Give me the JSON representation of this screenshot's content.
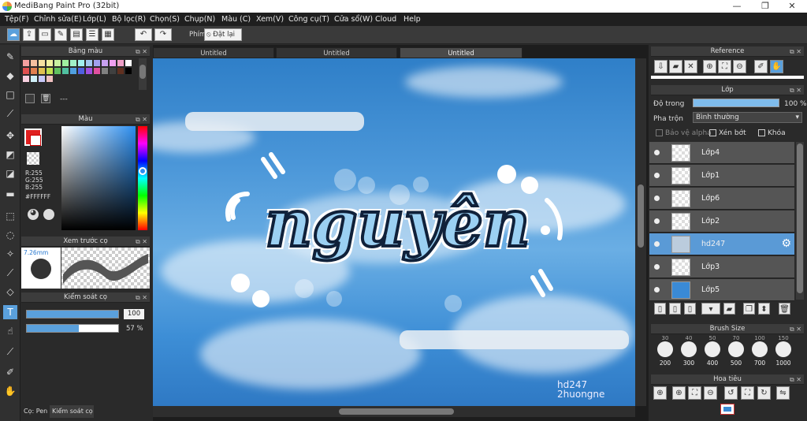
{
  "window": {
    "title": "MediBang Paint Pro (32bit)",
    "controls": [
      "—",
      "❐",
      "✕"
    ]
  },
  "menu": [
    "Tệp(F)",
    "Chỉnh sửa(E)",
    "Lớp(L)",
    "Bộ lọc(R)",
    "Chọn(S)",
    "Chụp(N)",
    "Màu (C)",
    "Xem(V)",
    "Công cụ(T)",
    "Cửa sổ(W)",
    "Cloud",
    "Help"
  ],
  "toolbar": {
    "hotkey_label": "Phím",
    "reset_label": "Đặt lại"
  },
  "palette": {
    "title": "Bảng màu",
    "set_name": "---",
    "colors": [
      "#f4a0a0",
      "#f5c0a0",
      "#f5e0a0",
      "#f0f0a0",
      "#c8f0a0",
      "#a0f0a0",
      "#a0f0c8",
      "#a0f0f0",
      "#a0c8f0",
      "#a0a0f0",
      "#c8a0f0",
      "#f0a0f0",
      "#f0a0c8",
      "#ffffff",
      "#e05050",
      "#e08050",
      "#e0c050",
      "#c0e050",
      "#60c060",
      "#50c0a0",
      "#50a0e0",
      "#5060e0",
      "#a050e0",
      "#e050a0",
      "#808080",
      "#404040",
      "#603020",
      "#000000",
      "#f8d0e0",
      "#d0f0f8",
      "#c8c8f8",
      "#f0c0c0"
    ]
  },
  "color": {
    "title": "Màu",
    "r": "R:255",
    "g": "G:255",
    "b": "B:255",
    "hex": "#FFFFFF"
  },
  "brush_preview": {
    "title": "Xem trước cọ",
    "size": "7.26mm"
  },
  "brush_control": {
    "title": "Kiểm soát cọ",
    "size_value": "100",
    "opacity_value": "57 %",
    "opacity": 0.57,
    "size": 1.0
  },
  "bottom_tabs": [
    "Cọ: Pen",
    "Kiểm soát cọ"
  ],
  "tabs": [
    "Untitled",
    "Untitled",
    "Untitled"
  ],
  "canvas": {
    "art_text": "nguyên",
    "watermark_line1": "hd247",
    "watermark_line2": "2huongne"
  },
  "reference": {
    "title": "Reference"
  },
  "layers": {
    "title": "Lớp",
    "opacity_label": "Độ trong",
    "opacity_value": "100 %",
    "blend_label": "Pha trộn",
    "blend_value": "Bình thường",
    "protect_alpha": "Bảo vệ alpha",
    "clipping": "Xén bớt",
    "lock": "Khóa",
    "items": [
      {
        "name": "Lớp4",
        "selected": false
      },
      {
        "name": "Lớp1",
        "selected": false
      },
      {
        "name": "Lớp6",
        "selected": false
      },
      {
        "name": "Lớp2",
        "selected": false
      },
      {
        "name": "hd247",
        "selected": true
      },
      {
        "name": "Lớp3",
        "selected": false
      },
      {
        "name": "Lớp5",
        "selected": false
      }
    ]
  },
  "brush_size": {
    "title": "Brush Size",
    "top_row": [
      "30",
      "40",
      "50",
      "70",
      "100",
      "150"
    ],
    "sizes": [
      "200",
      "300",
      "400",
      "500",
      "700",
      "1000"
    ]
  },
  "navigator": {
    "title": "Hoa tiêu"
  },
  "colors": {
    "accent": "#5aa0dc",
    "panel": "#2a2a2a"
  }
}
